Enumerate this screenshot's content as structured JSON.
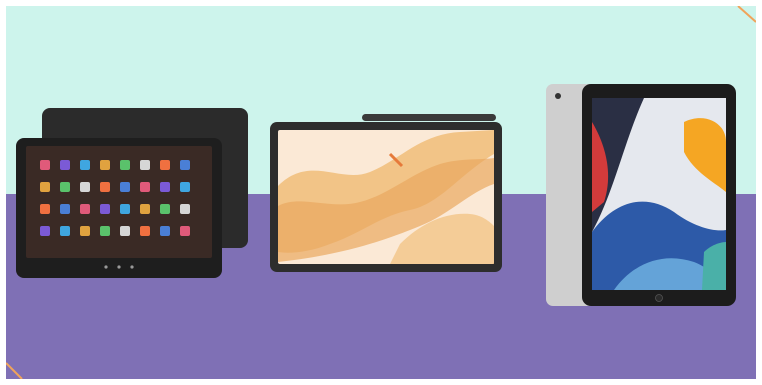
{
  "scene": {
    "colors": {
      "background_top": "#cdf4ec",
      "background_bottom": "#7f70b5",
      "corner_accent": "#f0a35a"
    }
  },
  "devices": [
    {
      "id": "fire-tablet",
      "kind": "tablet-front-and-back",
      "colors": {
        "body": "#2b2b2b",
        "screen": "#3a2a25"
      },
      "icon_grid_rows": 4,
      "icon_grid_cols": 8
    },
    {
      "id": "galaxy-tablet",
      "kind": "tablet-landscape-with-pen",
      "colors": {
        "body": "#2d2d2d",
        "wallpaper_primary": "#f2c487",
        "wallpaper_secondary": "#fbe9d6"
      }
    },
    {
      "id": "ipad",
      "kind": "tablet-portrait-front-and-back",
      "colors": {
        "back": "#cfcfcf",
        "bezel": "#1c1c1c",
        "wallpaper_accent": "#f5a623"
      }
    }
  ]
}
